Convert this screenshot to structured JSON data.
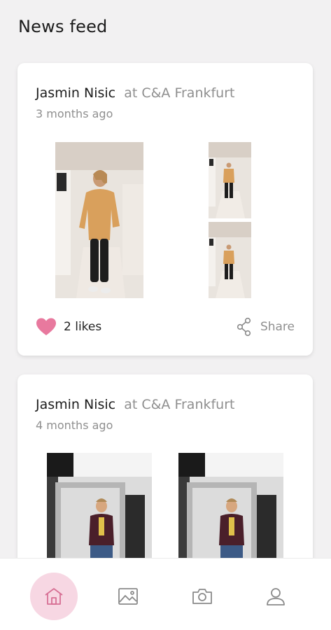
{
  "header": {
    "title": "News feed"
  },
  "posts": [
    {
      "author": "Jasmin Nisic",
      "location": "at C&A Frankfurt",
      "time": "3 months ago",
      "likes": "2 likes",
      "share_label": "Share"
    },
    {
      "author": "Jasmin Nisic",
      "location": "at C&A Frankfurt",
      "time": "4 months ago"
    }
  ],
  "bottom_nav": {
    "items": [
      {
        "icon": "home-icon",
        "active": true
      },
      {
        "icon": "gallery-icon",
        "active": false
      },
      {
        "icon": "camera-icon",
        "active": false
      },
      {
        "icon": "profile-icon",
        "active": false
      }
    ]
  },
  "colors": {
    "accent_pink": "#e8799e",
    "active_nav_bg": "#f7d7e3",
    "background": "#f2f1f2"
  }
}
